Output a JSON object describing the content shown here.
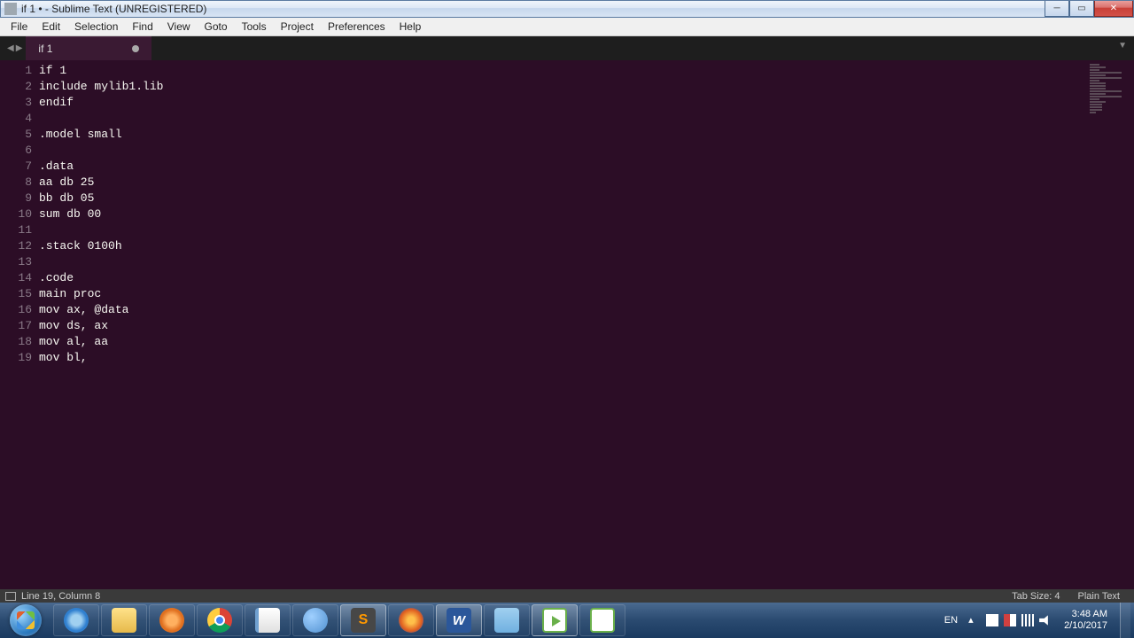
{
  "window": {
    "title": "if 1 • - Sublime Text (UNREGISTERED)"
  },
  "menubar": {
    "items": [
      "File",
      "Edit",
      "Selection",
      "Find",
      "View",
      "Goto",
      "Tools",
      "Project",
      "Preferences",
      "Help"
    ]
  },
  "tabs": {
    "active": {
      "label": "if 1",
      "dirty": true
    }
  },
  "editor": {
    "lines": [
      "if 1",
      "include mylib1.lib",
      "endif",
      "",
      ".model small",
      "",
      ".data",
      "aa db 25",
      "bb db 05",
      "sum db 00",
      "",
      ".stack 0100h",
      "",
      ".code",
      "main proc",
      "mov ax, @data",
      "mov ds, ax",
      "mov al, aa",
      "mov bl,"
    ]
  },
  "statusbar": {
    "position": "Line 19, Column 8",
    "tab_size": "Tab Size: 4",
    "syntax": "Plain Text"
  },
  "systray": {
    "lang": "EN",
    "time": "3:48 AM",
    "date": "2/10/2017"
  }
}
